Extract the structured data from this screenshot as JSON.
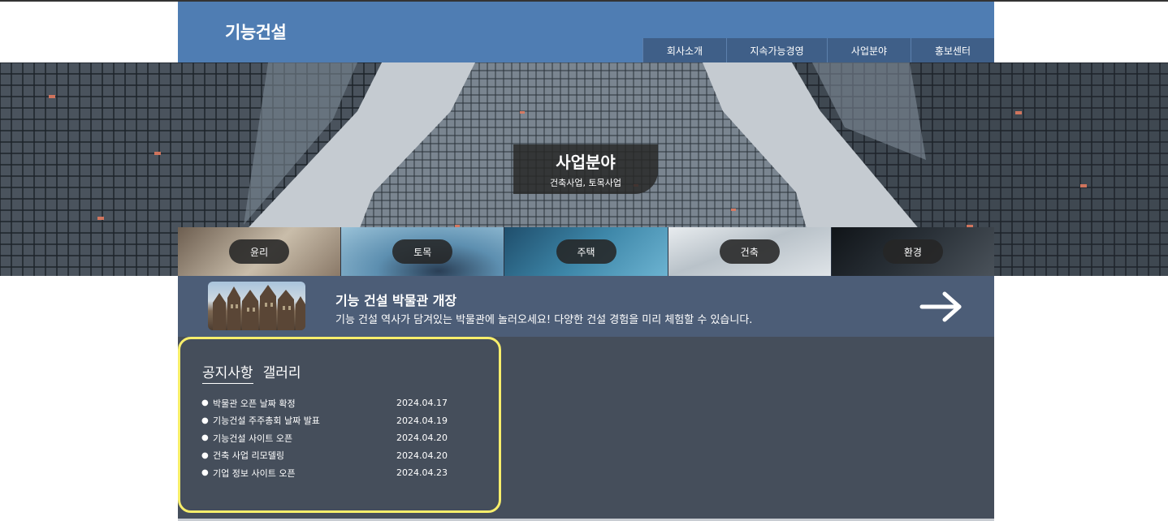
{
  "header": {
    "logo": "기능건설",
    "nav": [
      "회사소개",
      "지속가능경영",
      "사업분야",
      "홍보센터"
    ]
  },
  "hero": {
    "title": "사업분야",
    "subtitle": "건축사업, 토목사업"
  },
  "categories": [
    "윤리",
    "토목",
    "주택",
    "건축",
    "환경"
  ],
  "banner": {
    "title": "기능 건설 박물관 개장",
    "description": "기능 건설 역사가 담겨있는 박물관에 놀러오세요! 다양한 건설 경험을 미리 체험할 수 있습니다."
  },
  "board": {
    "tabs": [
      "공지사항",
      "갤러리"
    ],
    "active_tab": 0,
    "notices": [
      {
        "title": "박물관 오픈 날짜 확정",
        "date": "2024.04.17"
      },
      {
        "title": "기능건설 주주총회 날짜 발표",
        "date": "2024.04.19"
      },
      {
        "title": "기능건설 사이트 오픈",
        "date": "2024.04.20"
      },
      {
        "title": "건축 사업 리모델링",
        "date": "2024.04.20"
      },
      {
        "title": "기업 정보 사이트 오픈",
        "date": "2024.04.23"
      }
    ]
  },
  "colors": {
    "header": "#4f7db3",
    "nav": "#3f5f88",
    "banner": "#4c5d77",
    "content": "#454e5b",
    "highlight": "#f7ee6b"
  },
  "icons": {
    "banner_arrow": "arrow-right-icon"
  }
}
